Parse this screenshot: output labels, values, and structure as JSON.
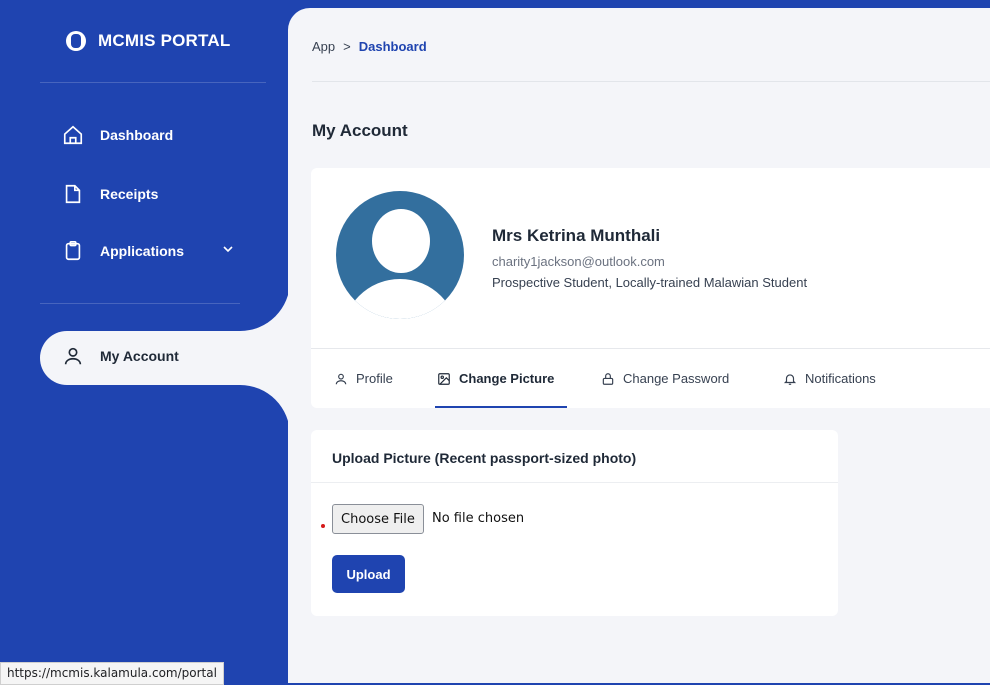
{
  "brand": {
    "title": "MCMIS PORTAL",
    "logo_icon": "caduceus-icon"
  },
  "sidebar": {
    "items": [
      {
        "label": "Dashboard",
        "icon": "home-icon"
      },
      {
        "label": "Receipts",
        "icon": "document-icon"
      },
      {
        "label": "Applications",
        "icon": "clipboard-icon"
      }
    ],
    "active": {
      "label": "My Account",
      "icon": "user-icon"
    }
  },
  "breadcrumb": {
    "root": "App",
    "separator": ">",
    "current": "Dashboard"
  },
  "page": {
    "title": "My Account"
  },
  "profile": {
    "name": "Mrs Ketrina Munthali",
    "email": "charity1jackson@outlook.com",
    "role": "Prospective Student, Locally-trained Malawian Student",
    "tabs": [
      {
        "label": "Profile",
        "icon": "user-icon"
      },
      {
        "label": "Change Picture",
        "icon": "image-icon",
        "active": true
      },
      {
        "label": "Change Password",
        "icon": "lock-icon"
      },
      {
        "label": "Notifications",
        "icon": "bell-icon"
      }
    ]
  },
  "upload": {
    "title": "Upload Picture (Recent passport-sized photo)",
    "choose_label": "Choose File",
    "file_status": "No file chosen",
    "button_label": "Upload"
  },
  "status_bar": {
    "url": "https://mcmis.kalamula.com/portal"
  },
  "colors": {
    "primary": "#1f44b0",
    "avatar_bg": "#336f9e",
    "page_bg": "#f4f5f9"
  }
}
